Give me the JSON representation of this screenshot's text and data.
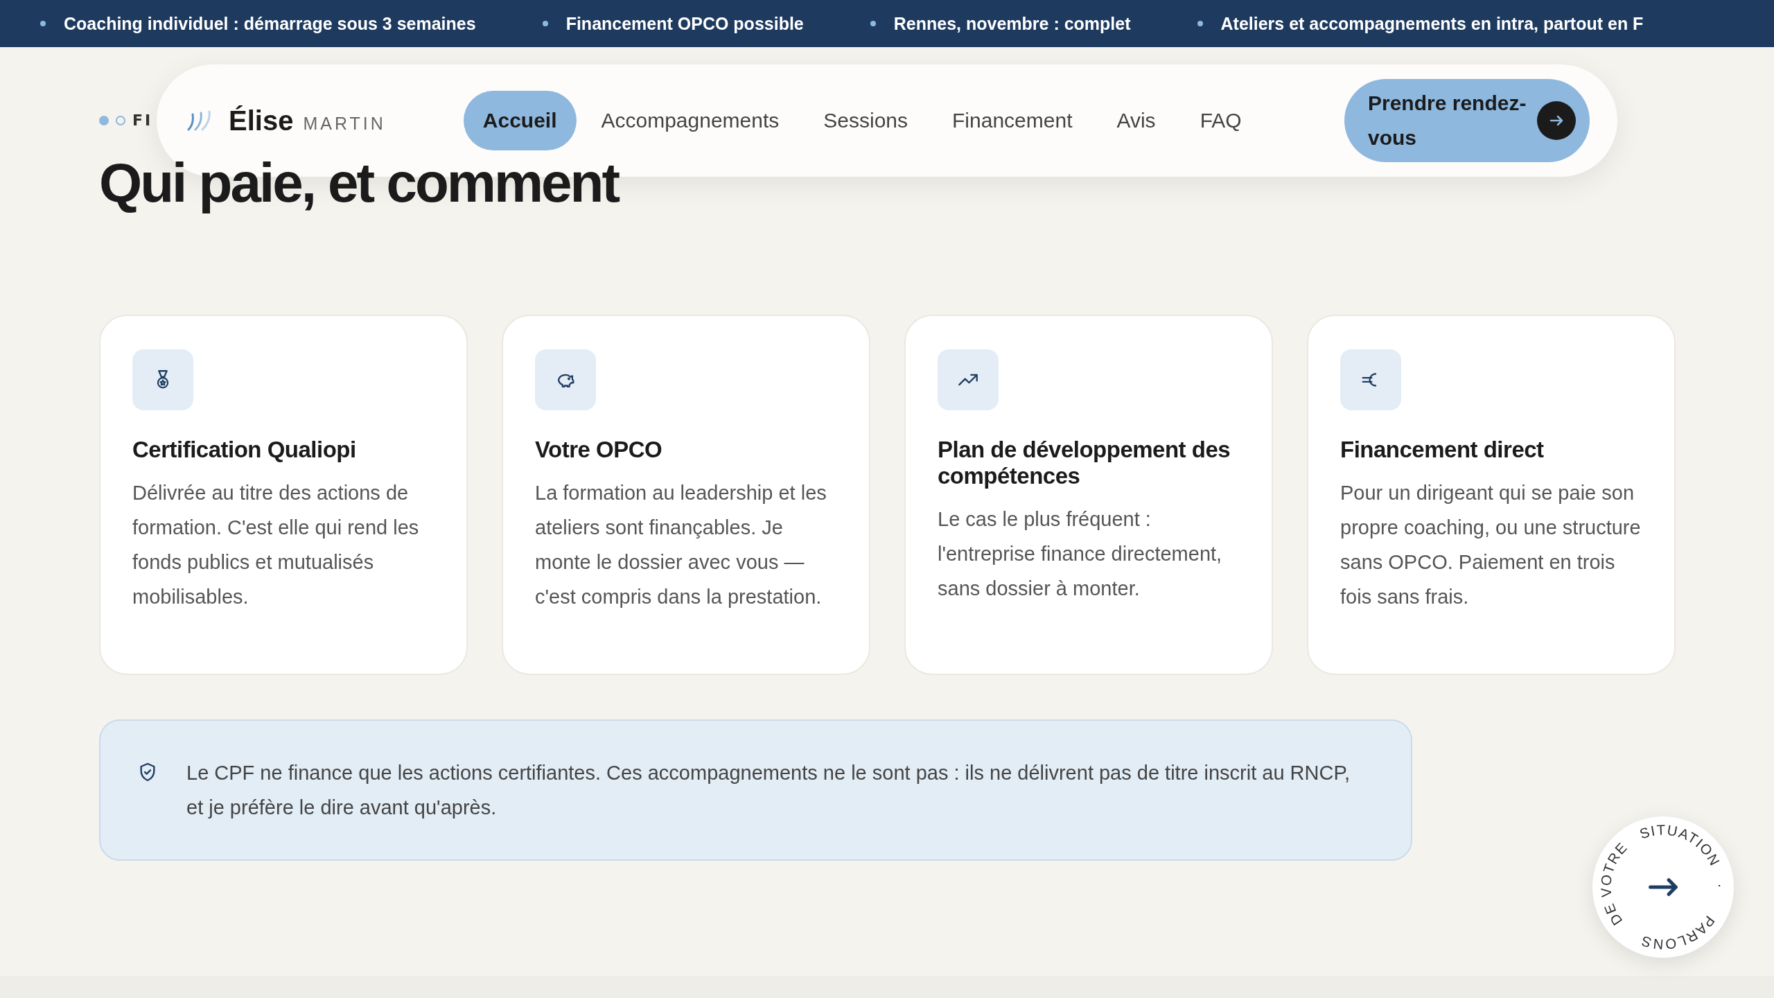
{
  "ticker": [
    "Coaching individuel : démarrage sous 3 semaines",
    "Financement OPCO possible",
    "Rennes, novembre : complet",
    "Ateliers et accompagnements en intra, partout en F"
  ],
  "eyebrow": {
    "dots": [
      {
        "filled": true
      },
      {
        "filled": false
      }
    ],
    "label": "FI"
  },
  "header": {
    "logo_first": "Élise",
    "logo_last": "MARTIN",
    "nav": [
      {
        "label": "Accueil",
        "selected": true
      },
      {
        "label": "Accompagnements",
        "selected": false
      },
      {
        "label": "Sessions",
        "selected": false
      },
      {
        "label": "Financement",
        "selected": false
      },
      {
        "label": "Avis",
        "selected": false
      },
      {
        "label": "FAQ",
        "selected": false
      }
    ],
    "cta": "Prendre rendez-vous"
  },
  "heading": "Qui paie, et comment",
  "cards": [
    {
      "title": "Certification Qualiopi",
      "body": "Délivrée au titre des actions de formation. C'est elle qui rend les fonds publics et mutualisés mobilisables."
    },
    {
      "title": "Votre OPCO",
      "body": "La formation au leadership et les ateliers sont finançables. Je monte le dossier avec vous — c'est compris dans la prestation."
    },
    {
      "title": "Plan de développement des compétences",
      "body": "Le cas le plus fréquent : l'entreprise finance directement, sans dossier à monter."
    },
    {
      "title": "Financement direct",
      "body": "Pour un dirigeant qui se paie son propre coaching, ou une structure sans OPCO. Paiement en trois fois sans frais."
    }
  ],
  "notice": "Le CPF ne finance que les actions certifiantes. Ces accompagnements ne le sont pas : ils ne délivrent pas de titre inscrit au RNCP, et je préfère le dire avant qu'après.",
  "round_badge": [
    "PARLONS",
    "DE VOTRE",
    "SITUATION",
    "·"
  ]
}
